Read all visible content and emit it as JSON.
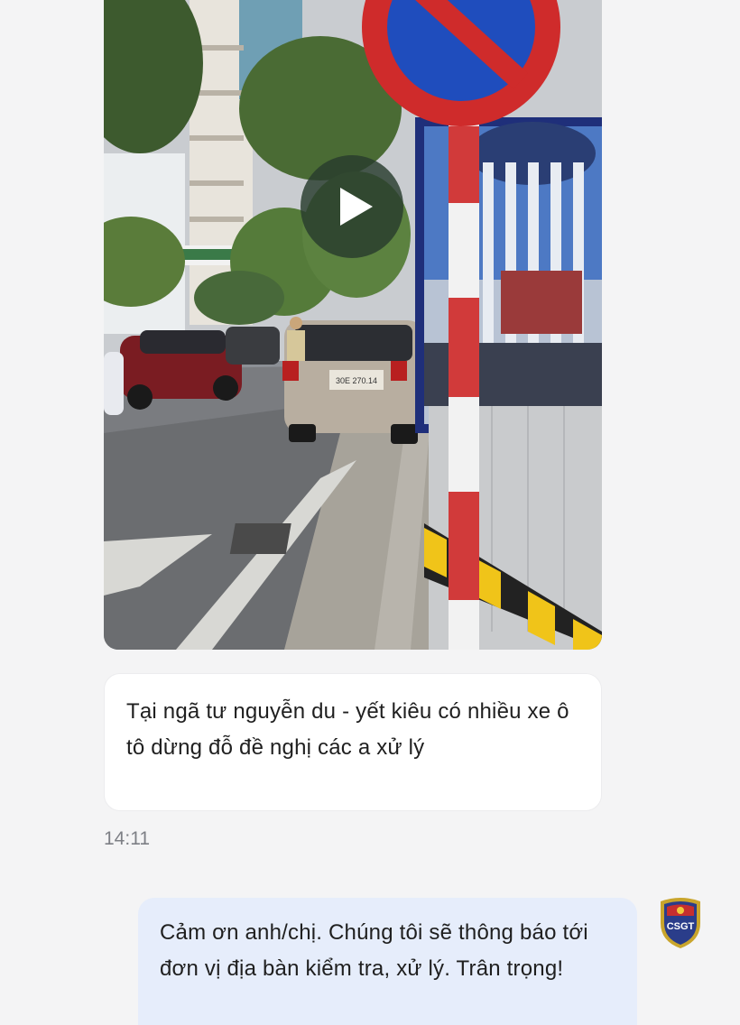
{
  "messages": {
    "incoming": {
      "text": "Tại ngã tư nguyễn du - yết kiêu có nhiều xe ô tô dừng đỗ đề nghị các a xử lý",
      "time": "14:11"
    },
    "outgoing": {
      "text": "Cảm ơn anh/chị. Chúng tôi sẽ thông báo tới đơn vị địa bàn kiểm tra, xử lý. Trân trọng!"
    }
  },
  "video": {
    "plate_text": "30E\n270.14"
  },
  "avatar": {
    "badge_text": "CSGT"
  },
  "colors": {
    "incoming_bubble": "#ffffff",
    "outgoing_bubble": "#e6edfb",
    "timestamp": "#7d7f85",
    "background": "#f4f4f5"
  },
  "icons": {
    "play": "play-icon",
    "avatar": "police-badge-icon"
  }
}
